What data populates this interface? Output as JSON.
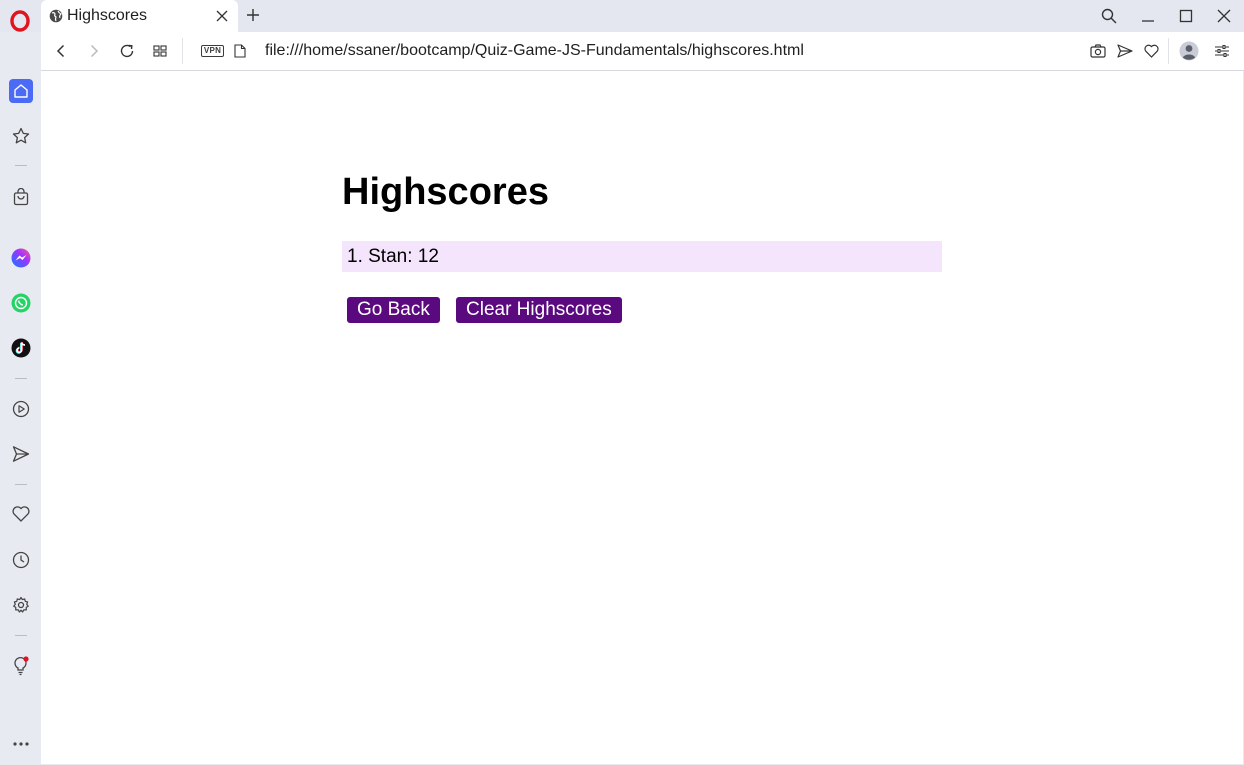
{
  "browser": {
    "tab": {
      "title": "Highscores"
    },
    "address_bar": {
      "vpn_label": "VPN",
      "url": "file:///home/ssaner/bootcamp/Quiz-Game-JS-Fundamentals/highscores.html"
    },
    "accent_color": "#4b6bf5",
    "sidebar_items": [
      "home-icon",
      "bookmarks-icon",
      "shopping-icon",
      "messenger-icon",
      "whatsapp-icon",
      "tiktok-icon",
      "player-icon",
      "send-icon",
      "heart-icon",
      "history-icon",
      "settings-icon",
      "tips-icon",
      "more-icon"
    ]
  },
  "page": {
    "title": "Highscores",
    "scores": [
      {
        "text": "1. Stan: 12"
      }
    ],
    "buttons": {
      "go_back": "Go Back",
      "clear": "Clear Highscores"
    },
    "colors": {
      "button_bg": "#5a0a7e",
      "score_bg": "#f4e4fc"
    }
  }
}
